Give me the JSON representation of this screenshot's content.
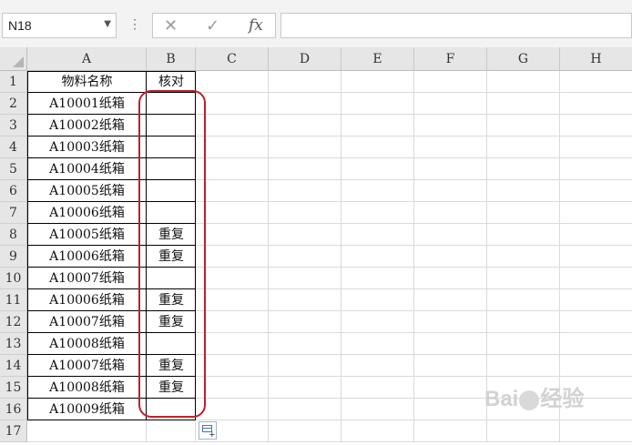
{
  "formula_bar": {
    "name_box": "N18",
    "menu_dots": "⋮",
    "cancel_symbol": "✕",
    "enter_symbol": "✓",
    "fx_label": "fx",
    "formula": ""
  },
  "columns": [
    "A",
    "B",
    "C",
    "D",
    "E",
    "F",
    "G",
    "H"
  ],
  "rows": [
    "1",
    "2",
    "3",
    "4",
    "5",
    "6",
    "7",
    "8",
    "9",
    "10",
    "11",
    "12",
    "13",
    "14",
    "15",
    "16",
    "17"
  ],
  "cells": {
    "A": [
      "物料名称",
      "A10001纸箱",
      "A10002纸箱",
      "A10003纸箱",
      "A10004纸箱",
      "A10005纸箱",
      "A10006纸箱",
      "A10005纸箱",
      "A10006纸箱",
      "A10007纸箱",
      "A10006纸箱",
      "A10007纸箱",
      "A10008纸箱",
      "A10007纸箱",
      "A10008纸箱",
      "A10009纸箱",
      ""
    ],
    "B": [
      "核对",
      "",
      "",
      "",
      "",
      "",
      "",
      "重复",
      "重复",
      "",
      "重复",
      "重复",
      "",
      "重复",
      "重复",
      "",
      ""
    ]
  },
  "annotation": {
    "oval_color": "#c0202a"
  },
  "watermark": {
    "text_left": "Bai",
    "text_right": "经验"
  }
}
